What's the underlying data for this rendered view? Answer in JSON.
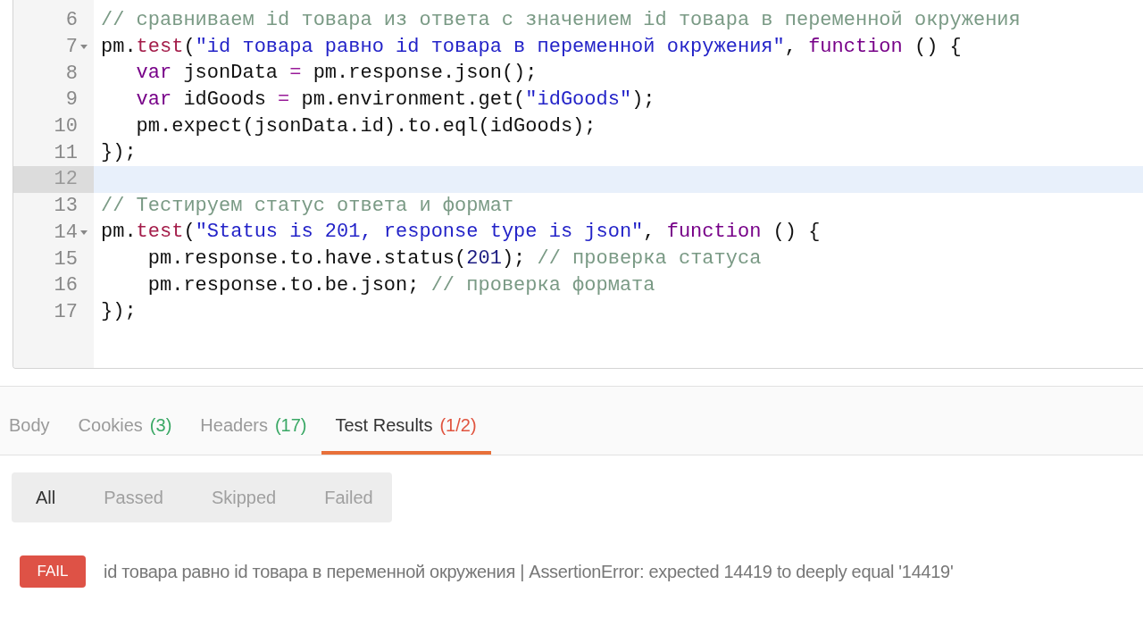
{
  "editor": {
    "lines": [
      {
        "number": "6",
        "fold": false,
        "active": false,
        "tokens": [
          {
            "kind": "comment",
            "text": "// сравниваем id товара из ответа с значением id товара в переменной окружения"
          }
        ]
      },
      {
        "number": "7",
        "fold": true,
        "active": false,
        "tokens": [
          {
            "kind": "plain",
            "text": "pm."
          },
          {
            "kind": "property",
            "text": "test"
          },
          {
            "kind": "plain",
            "text": "("
          },
          {
            "kind": "string",
            "text": "\"id товара равно id товара в переменной окружения\""
          },
          {
            "kind": "plain",
            "text": ", "
          },
          {
            "kind": "keyword",
            "text": "function"
          },
          {
            "kind": "plain",
            "text": " () {"
          }
        ]
      },
      {
        "number": "8",
        "fold": false,
        "active": false,
        "tokens": [
          {
            "kind": "keyword",
            "text": "   var"
          },
          {
            "kind": "plain",
            "text": " jsonData "
          },
          {
            "kind": "operator",
            "text": "="
          },
          {
            "kind": "plain",
            "text": " pm.response.json();"
          }
        ]
      },
      {
        "number": "9",
        "fold": false,
        "active": false,
        "tokens": [
          {
            "kind": "keyword",
            "text": "   var"
          },
          {
            "kind": "plain",
            "text": " idGoods "
          },
          {
            "kind": "operator",
            "text": "="
          },
          {
            "kind": "plain",
            "text": " pm.environment.get("
          },
          {
            "kind": "string",
            "text": "\"idGoods\""
          },
          {
            "kind": "plain",
            "text": ");"
          }
        ]
      },
      {
        "number": "10",
        "fold": false,
        "active": false,
        "tokens": [
          {
            "kind": "plain",
            "text": "   pm.expect(jsonData.id).to.eql(idGoods);"
          }
        ]
      },
      {
        "number": "11",
        "fold": false,
        "active": false,
        "tokens": [
          {
            "kind": "plain",
            "text": "});"
          }
        ]
      },
      {
        "number": "12",
        "fold": false,
        "active": true
      },
      {
        "number": "13",
        "fold": false,
        "active": false,
        "tokens": [
          {
            "kind": "comment",
            "text": "// Тестируем статус ответа и формат"
          }
        ]
      },
      {
        "number": "14",
        "fold": true,
        "active": false,
        "tokens": [
          {
            "kind": "plain",
            "text": "pm."
          },
          {
            "kind": "property",
            "text": "test"
          },
          {
            "kind": "plain",
            "text": "("
          },
          {
            "kind": "string",
            "text": "\"Status is 201, response type is json\""
          },
          {
            "kind": "plain",
            "text": ", "
          },
          {
            "kind": "keyword",
            "text": "function"
          },
          {
            "kind": "plain",
            "text": " () {"
          }
        ]
      },
      {
        "number": "15",
        "fold": false,
        "active": false,
        "tokens": [
          {
            "kind": "plain",
            "text": "    pm.response.to.have.status("
          },
          {
            "kind": "number",
            "text": "201"
          },
          {
            "kind": "plain",
            "text": "); "
          },
          {
            "kind": "comment",
            "text": "// проверка статуса"
          }
        ]
      },
      {
        "number": "16",
        "fold": false,
        "active": false,
        "tokens": [
          {
            "kind": "plain",
            "text": "    pm.response.to.be.json; "
          },
          {
            "kind": "comment",
            "text": "// проверка формата"
          }
        ]
      },
      {
        "number": "17",
        "fold": false,
        "active": false,
        "tokens": [
          {
            "kind": "plain",
            "text": "});"
          }
        ]
      }
    ]
  },
  "tabs": [
    {
      "label": "Body",
      "selected": false
    },
    {
      "label": "Cookies",
      "count": "(3)",
      "color": "#3aa865",
      "selected": false
    },
    {
      "label": "Headers",
      "count": "(17)",
      "color": "#3aa865",
      "selected": false
    },
    {
      "label": "Test Results",
      "count": "(1/2)",
      "color": "#e0543f",
      "selected": true
    }
  ],
  "filters": [
    {
      "label": "All",
      "selected": true
    },
    {
      "label": "Passed",
      "selected": false
    },
    {
      "label": "Skipped",
      "selected": false
    },
    {
      "label": "Failed",
      "selected": false
    }
  ],
  "results": [
    {
      "status": "FAIL",
      "kind": "fail",
      "message": "id товара равно id товара в переменной окружения | AssertionError: expected 14419 to deeply equal '14419'"
    }
  ]
}
